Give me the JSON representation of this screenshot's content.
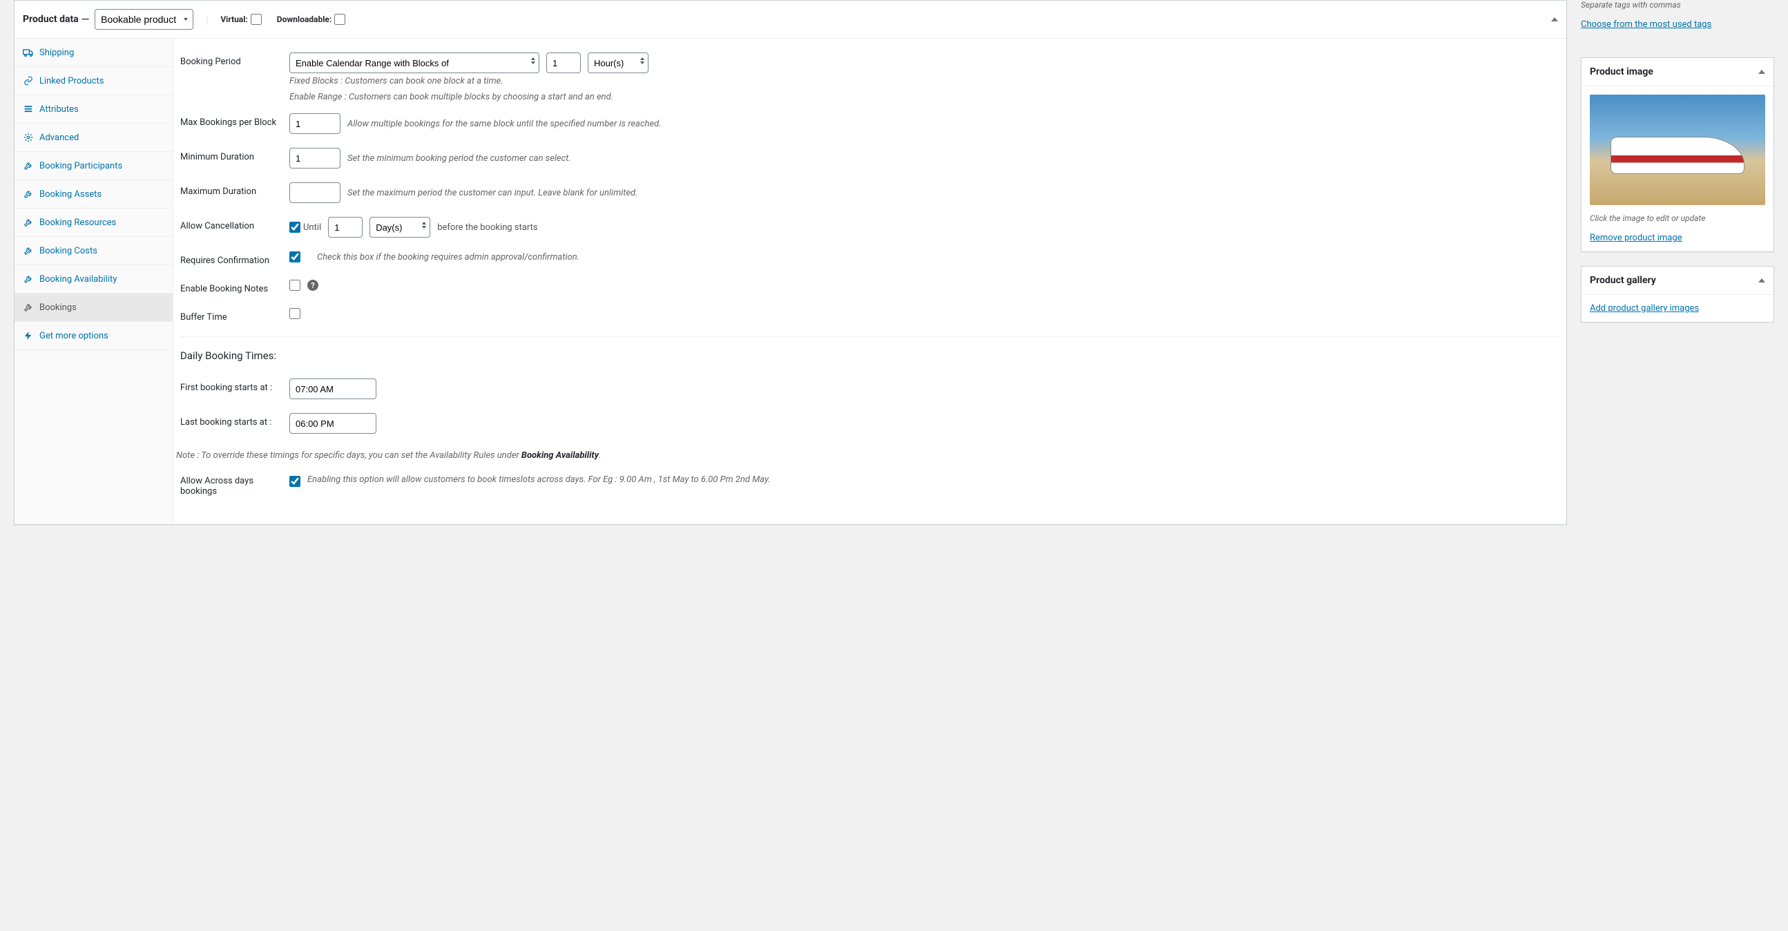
{
  "header": {
    "title": "Product data",
    "productType": "Bookable product",
    "virtualLabel": "Virtual:",
    "downloadableLabel": "Downloadable:"
  },
  "tabs": [
    {
      "id": "shipping",
      "label": "Shipping",
      "icon": "truck"
    },
    {
      "id": "linked",
      "label": "Linked Products",
      "icon": "link"
    },
    {
      "id": "attributes",
      "label": "Attributes",
      "icon": "list"
    },
    {
      "id": "advanced",
      "label": "Advanced",
      "icon": "gear"
    },
    {
      "id": "participants",
      "label": "Booking Participants",
      "icon": "wrench"
    },
    {
      "id": "assets",
      "label": "Booking Assets",
      "icon": "wrench"
    },
    {
      "id": "resources",
      "label": "Booking Resources",
      "icon": "wrench"
    },
    {
      "id": "costs",
      "label": "Booking Costs",
      "icon": "wrench"
    },
    {
      "id": "availability",
      "label": "Booking Availability",
      "icon": "wrench"
    },
    {
      "id": "bookings",
      "label": "Bookings",
      "icon": "wrench",
      "active": true
    },
    {
      "id": "getmore",
      "label": "Get more options",
      "icon": "bolt"
    }
  ],
  "booking": {
    "periodLabel": "Booking Period",
    "periodSelect": "Enable Calendar Range with Blocks of",
    "periodValue": "1",
    "periodUnit": "Hour(s)",
    "hintFixed": "Fixed Blocks : Customers can book one block at a time.",
    "hintRange": "Enable Range : Customers can book multiple blocks by choosing a start and an end.",
    "maxPerBlockLabel": "Max Bookings per Block",
    "maxPerBlockValue": "1",
    "maxPerBlockHint": "Allow multiple bookings for the same block until the specified number is reached.",
    "minDurationLabel": "Minimum Duration",
    "minDurationValue": "1",
    "minDurationHint": "Set the minimum booking period the customer can select.",
    "maxDurationLabel": "Maximum Duration",
    "maxDurationValue": "",
    "maxDurationHint": "Set the maximum period the customer can input. Leave blank for unlimited.",
    "allowCancelLabel": "Allow Cancellation",
    "allowCancelChecked": true,
    "untilWord": "Until",
    "cancelValue": "1",
    "cancelUnit": "Day(s)",
    "cancelSuffix": "before the booking starts",
    "requiresConfirmLabel": "Requires Confirmation",
    "requiresConfirmChecked": true,
    "requiresConfirmHint": "Check this box if the booking requires admin approval/confirmation.",
    "notesLabel": "Enable Booking Notes",
    "bufferLabel": "Buffer Time"
  },
  "daily": {
    "heading": "Daily Booking Times:",
    "firstLabel": "First booking starts at :",
    "firstValue": "07:00 AM",
    "lastLabel": "Last booking starts at :",
    "lastValue": "06:00 PM",
    "notePrefix": "Note : To override these timings for specific days, you can set the Availability Rules under ",
    "noteBold": "Booking Availability",
    "noteSuffix": ".",
    "acrossLabel": "Allow Across days bookings",
    "acrossChecked": true,
    "acrossHint": "Enabling this option will allow customers to book timeslots across days. For Eg : 9.00 Am , 1st May to 6.00 Pm 2nd May."
  },
  "tags": {
    "separateHint": "Separate tags with commas",
    "choose": "Choose from the most used tags"
  },
  "image": {
    "title": "Product image",
    "clickHint": "Click the image to edit or update",
    "removeLink": "Remove product image"
  },
  "gallery": {
    "title": "Product gallery",
    "addLink": "Add product gallery images"
  }
}
